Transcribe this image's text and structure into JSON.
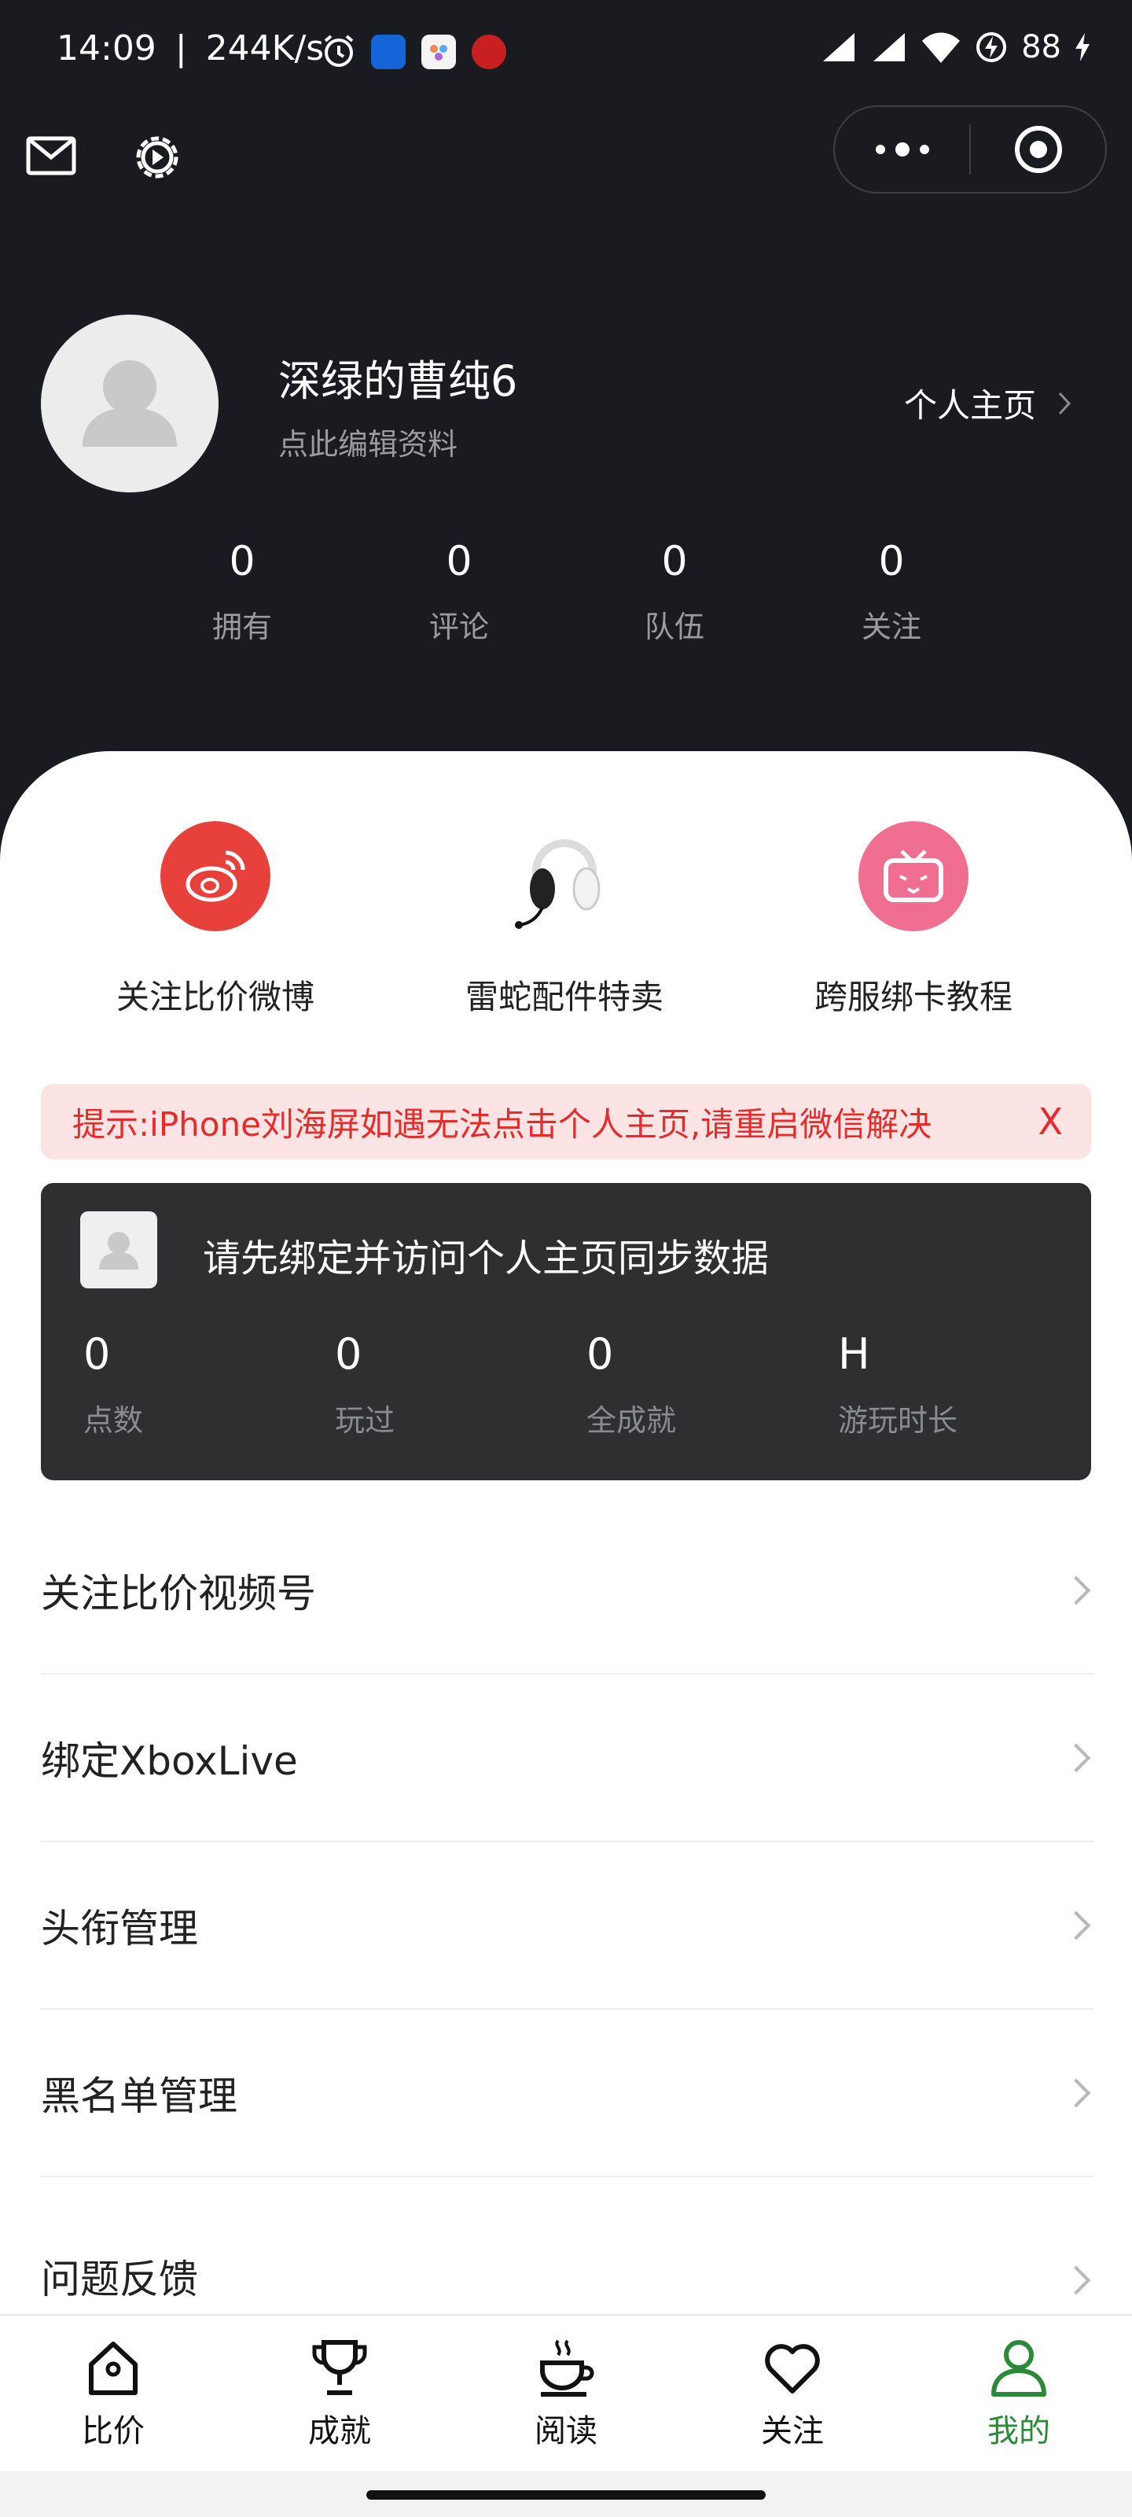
{
  "status_bar": {
    "time": "14:09",
    "net_speed": "244K/s",
    "battery": "88"
  },
  "profile": {
    "username": "深绿的曹纯6",
    "edit_hint": "点此编辑资料",
    "homepage_link": "个人主页",
    "stats": [
      {
        "value": "0",
        "label": "拥有"
      },
      {
        "value": "0",
        "label": "评论"
      },
      {
        "value": "0",
        "label": "队伍"
      },
      {
        "value": "0",
        "label": "关注"
      }
    ]
  },
  "shortcuts": [
    {
      "label": "关注比价微博",
      "icon": "weibo-icon",
      "color": "#e8403a"
    },
    {
      "label": "雷蛇配件特卖",
      "icon": "headset-icon",
      "color": "#ffffff"
    },
    {
      "label": "跨服绑卡教程",
      "icon": "bilibili-icon",
      "color": "#f06e8f"
    }
  ],
  "notice": {
    "text": "提示:iPhone刘海屏如遇无法点击个人主页,请重启微信解决",
    "close": "X"
  },
  "sync_card": {
    "title": "请先绑定并访问个人主页同步数据",
    "stats": [
      {
        "value": "0",
        "label": "点数"
      },
      {
        "value": "0",
        "label": "玩过"
      },
      {
        "value": "0",
        "label": "全成就"
      },
      {
        "value": "H",
        "label": "游玩时长"
      }
    ]
  },
  "menu": [
    {
      "label": "关注比价视频号"
    },
    {
      "label": "绑定XboxLive"
    },
    {
      "label": "头衔管理"
    },
    {
      "label": "黑名单管理"
    },
    {
      "label": "问题反馈"
    }
  ],
  "tabs": [
    {
      "label": "比价",
      "icon": "home-tag-icon",
      "active": false
    },
    {
      "label": "成就",
      "icon": "trophy-icon",
      "active": false
    },
    {
      "label": "阅读",
      "icon": "coffee-cup-icon",
      "active": false
    },
    {
      "label": "关注",
      "icon": "heart-icon",
      "active": false
    },
    {
      "label": "我的",
      "icon": "person-icon",
      "active": true
    }
  ],
  "colors": {
    "header_bg": "#1a1b20",
    "accent_green": "#2a8a3a",
    "notice_red": "#e62b2b",
    "card_bg": "#2f2f31"
  }
}
